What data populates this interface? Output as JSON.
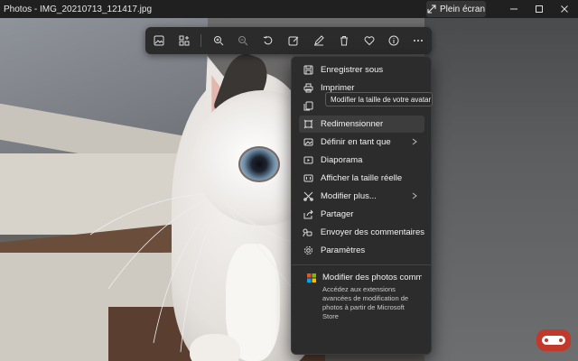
{
  "window": {
    "title": "Photos - IMG_20210713_121417.jpg",
    "fullscreen_label": "Plein écran",
    "fullscreen_icon": "expand-icon",
    "controls": [
      "minimize-icon",
      "maximize-icon",
      "close-icon"
    ]
  },
  "toolbar": {
    "buttons": [
      {
        "name": "view-photo-icon"
      },
      {
        "name": "add-to-album-icon"
      },
      {
        "name": "zoom-in-icon"
      },
      {
        "name": "zoom-out-icon"
      },
      {
        "name": "rotate-icon"
      },
      {
        "name": "edit-image-icon"
      },
      {
        "name": "draw-icon"
      },
      {
        "name": "delete-icon"
      },
      {
        "name": "favorite-icon"
      },
      {
        "name": "info-icon"
      },
      {
        "name": "more-icon"
      }
    ]
  },
  "menu": {
    "items": [
      {
        "label": "Enregistrer sous",
        "icon": "save-icon",
        "submenu": false
      },
      {
        "label": "Imprimer",
        "icon": "print-icon",
        "submenu": false
      },
      {
        "label": "",
        "icon": "copy-icon",
        "submenu": false
      },
      {
        "label": "Redimensionner",
        "icon": "resize-icon",
        "submenu": false,
        "hover": true
      },
      {
        "label": "Définir en tant que",
        "icon": "set-as-icon",
        "submenu": true
      },
      {
        "label": "Diaporama",
        "icon": "slideshow-icon",
        "submenu": false
      },
      {
        "label": "Afficher la taille réelle",
        "icon": "actual-size-icon",
        "submenu": false
      },
      {
        "label": "Modifier plus...",
        "icon": "edit-more-icon",
        "submenu": true
      },
      {
        "label": "Partager",
        "icon": "share-icon",
        "submenu": false
      },
      {
        "label": "Envoyer des commentaires",
        "icon": "feedback-icon",
        "submenu": false
      },
      {
        "label": "Paramètres",
        "icon": "settings-icon",
        "submenu": false
      }
    ],
    "extension": {
      "title": "Modifier des photos comm",
      "description": "Accédez aux extensions avancées de modification de photos à partir de Microsoft Store",
      "icon": "store-icon"
    }
  },
  "tooltip": {
    "text": "Modifier la taille de votre avatar"
  },
  "colors": {
    "menu_bg": "#2c2c2c",
    "toolbar_bg": "#2b2b2b",
    "titlebar_bg": "#202020",
    "hover_bg": "#3d3d3d"
  }
}
